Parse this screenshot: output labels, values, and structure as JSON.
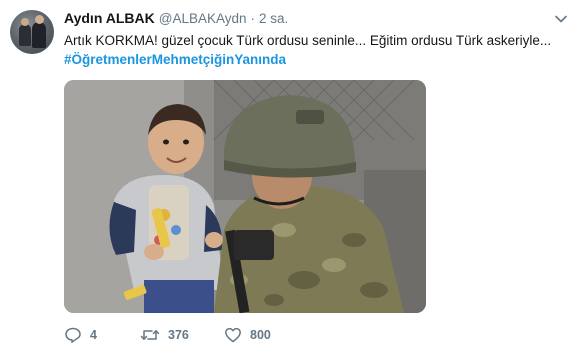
{
  "tweet": {
    "display_name": "Aydın ALBAK",
    "handle": "@ALBAKAydn",
    "separator": "·",
    "time": "2 sa.",
    "text": "Artık KORKMA! güzel çocuk Türk ordusu seninle... Eğitim ordusu Türk askeriyle...",
    "hashtag": "#ÖğretmenlerMehmetçiğinYanında"
  },
  "actions": {
    "reply_count": "4",
    "retweet_count": "376",
    "like_count": "800"
  },
  "colors": {
    "text": "#14171a",
    "muted": "#657786",
    "link": "#1b95e0"
  },
  "icons": {
    "reply": "reply-icon",
    "retweet": "retweet-icon",
    "like": "heart-icon",
    "menu": "chevron-down-icon"
  }
}
